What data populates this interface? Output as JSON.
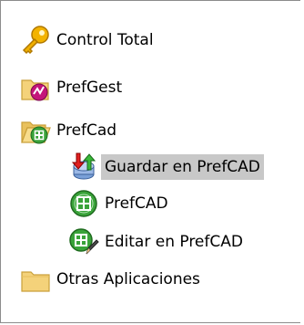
{
  "tree": {
    "items": [
      {
        "label": "Control Total",
        "icon": "key-icon",
        "level": 0
      },
      {
        "label": "PrefGest",
        "icon": "folder-prefgest-icon",
        "level": 0
      },
      {
        "label": "PrefCad",
        "icon": "folder-open-prefcad-icon",
        "level": 0
      },
      {
        "label": "Guardar en PrefCAD",
        "icon": "save-prefcad-icon",
        "level": 1,
        "selected": true
      },
      {
        "label": "PrefCAD",
        "icon": "prefcad-app-icon",
        "level": 1
      },
      {
        "label": "Editar en PrefCAD",
        "icon": "edit-prefcad-icon",
        "level": 1
      },
      {
        "label": "Otras Aplicaciones",
        "icon": "folder-icon",
        "level": 0
      }
    ]
  },
  "colors": {
    "selection": "#c8c8c8",
    "folder": "#f4d27a",
    "key": "#f0b400",
    "prefcad_green": "#3aa33a",
    "prefgest_magenta": "#c4147a"
  }
}
